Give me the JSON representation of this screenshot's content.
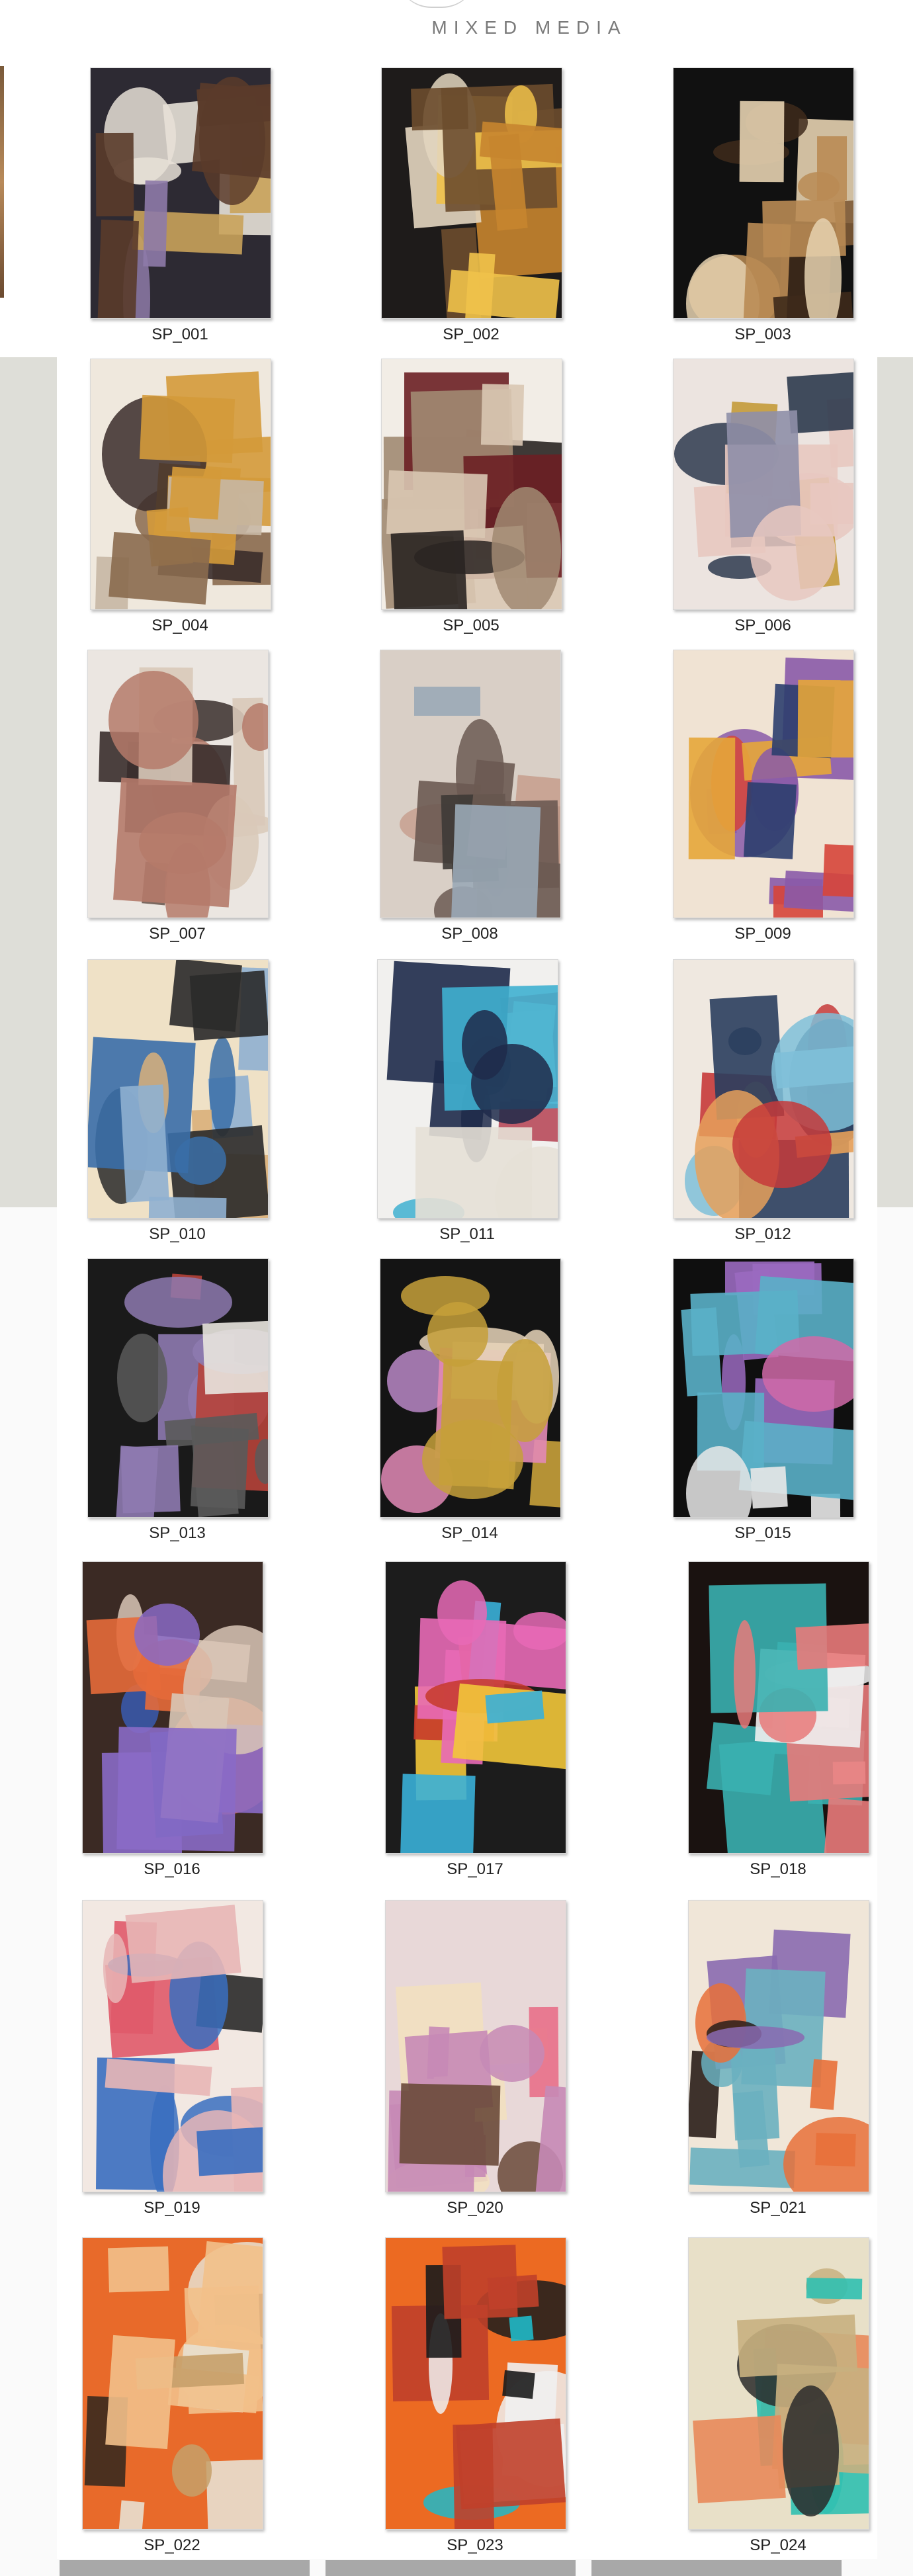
{
  "header": {
    "title": "MIXED MEDIA"
  },
  "gallery": {
    "items": [
      {
        "label": "SP_001",
        "colors": [
          "#2d2a33",
          "#c9a25a",
          "#8e7aa8",
          "#e7e1d7",
          "#5a3b2a"
        ]
      },
      {
        "label": "SP_002",
        "colors": [
          "#1e1b1a",
          "#c6852f",
          "#e3d6c0",
          "#6b4c2e",
          "#f0c24a"
        ]
      },
      {
        "label": "SP_003",
        "colors": [
          "#111111",
          "#b98b54",
          "#e6d2b0",
          "#3e2a1b",
          "#7d5a36"
        ]
      },
      {
        "label": "SP_004",
        "colors": [
          "#efe8dd",
          "#d49a3a",
          "#3a2c2a",
          "#c7b7a4",
          "#8a6a4e"
        ]
      },
      {
        "label": "SP_005",
        "colors": [
          "#f2ede6",
          "#2a2522",
          "#a18a72",
          "#6b1f24",
          "#d9c7b3"
        ]
      },
      {
        "label": "SP_006",
        "colors": [
          "#ece4e0",
          "#2e3a4e",
          "#c49a3a",
          "#8f8fa8",
          "#e8c8c0"
        ]
      },
      {
        "label": "SP_007",
        "colors": [
          "#ebe6e1",
          "#3a2e2c",
          "#b57a6a",
          "#d9c9b9",
          "#6e5a52"
        ]
      },
      {
        "label": "SP_008",
        "colors": [
          "#d9cfc6",
          "#6b5a52",
          "#9aa8b6",
          "#c7a08f",
          "#3e3a36"
        ]
      },
      {
        "label": "SP_009",
        "colors": [
          "#f0e3d3",
          "#2c3e6e",
          "#d6453a",
          "#e6a63a",
          "#8a5aa8"
        ]
      },
      {
        "label": "SP_010",
        "colors": [
          "#efe1c6",
          "#3a6ea8",
          "#2a2a2a",
          "#d9b07a",
          "#8fb0d0"
        ]
      },
      {
        "label": "SP_011",
        "colors": [
          "#f1f0ee",
          "#1e2a4a",
          "#3fb0d0",
          "#b84a5a",
          "#e6e0d6"
        ]
      },
      {
        "label": "SP_012",
        "colors": [
          "#efe8e0",
          "#2a3e5e",
          "#c63a3a",
          "#e6a05a",
          "#7fc0d8"
        ]
      },
      {
        "label": "SP_013",
        "colors": [
          "#1a1a1a",
          "#8e7ab0",
          "#e8e4de",
          "#b6423a",
          "#5a5a5a"
        ]
      },
      {
        "label": "SP_014",
        "colors": [
          "#141414",
          "#b887c6",
          "#e6d3b8",
          "#c6a03a",
          "#e28ab6"
        ]
      },
      {
        "label": "SP_015",
        "colors": [
          "#0f0f0f",
          "#9a6ac0",
          "#e8e8e8",
          "#5ab0c8",
          "#d06aa8"
        ]
      },
      {
        "label": "SP_016",
        "colors": [
          "#3b2a24",
          "#8a6ac6",
          "#e66a3a",
          "#d9c6b6",
          "#3a5ab0"
        ]
      },
      {
        "label": "SP_017",
        "colors": [
          "#1c1c1c",
          "#e86ab6",
          "#3ab0d8",
          "#f2c63a",
          "#c63a2a"
        ]
      },
      {
        "label": "SP_018",
        "colors": [
          "#1a1210",
          "#e87a7a",
          "#f0f0f0",
          "#3ab0b0",
          "#f2c03a"
        ]
      },
      {
        "label": "SP_019",
        "colors": [
          "#f2e8e2",
          "#e05a6a",
          "#3a6ec0",
          "#2a2a2a",
          "#e8b6b6"
        ]
      },
      {
        "label": "SP_020",
        "colors": [
          "#e8d8d8",
          "#c68ab6",
          "#6a4a3a",
          "#e8708a",
          "#f2e0c0"
        ]
      },
      {
        "label": "SP_021",
        "colors": [
          "#f0e6d8",
          "#e8703a",
          "#2a1e1a",
          "#8a6ab0",
          "#6ab0c0"
        ]
      },
      {
        "label": "SP_022",
        "colors": [
          "#e86a2a",
          "#f2c08a",
          "#3a2a1e",
          "#c6a06a",
          "#e8e0d0"
        ]
      },
      {
        "label": "SP_023",
        "colors": [
          "#ec6a22",
          "#20b8c8",
          "#1c1c1c",
          "#f0f0f0",
          "#c0402a"
        ]
      },
      {
        "label": "SP_024",
        "colors": [
          "#e8e0c8",
          "#30c0b0",
          "#2a2a2a",
          "#e88a5a",
          "#c8b080"
        ]
      }
    ]
  }
}
